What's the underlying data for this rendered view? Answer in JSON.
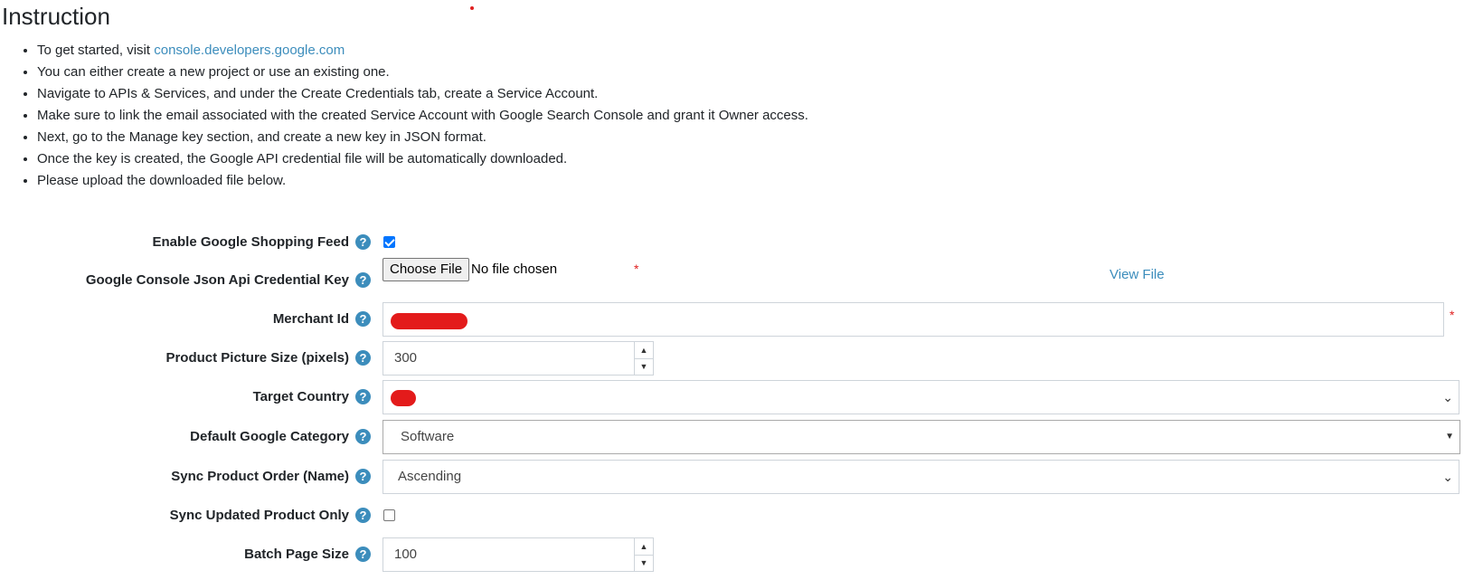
{
  "page": {
    "title": "Instruction",
    "instructions": [
      {
        "text": "To get started, visit ",
        "link": "console.developers.google.com"
      },
      {
        "text": "You can either create a new project or use an existing one."
      },
      {
        "text": "Navigate to APIs & Services, and under the Create Credentials tab, create a Service Account."
      },
      {
        "text": "Make sure to link the email associated with the created Service Account with Google Search Console and grant it Owner access."
      },
      {
        "text": "Next, go to the Manage key section, and create a new key in JSON format."
      },
      {
        "text": "Once the key is created, the Google API credential file will be automatically downloaded."
      },
      {
        "text": "Please upload the downloaded file below."
      }
    ]
  },
  "form": {
    "help_glyph": "?",
    "required_mark": "*",
    "enable_feed": {
      "label": "Enable Google Shopping Feed",
      "checked": true
    },
    "credential_key": {
      "label": "Google Console Json Api Credential Key",
      "button": "Choose File",
      "status": "No file chosen",
      "view_link": "View File"
    },
    "merchant_id": {
      "label": "Merchant Id",
      "value_redacted": true
    },
    "picture_size": {
      "label": "Product Picture Size (pixels)",
      "value": "300"
    },
    "target_country": {
      "label": "Target Country",
      "value_redacted": true
    },
    "default_category": {
      "label": "Default Google Category",
      "value": "Software"
    },
    "sync_order": {
      "label": "Sync Product Order (Name)",
      "value": "Ascending"
    },
    "sync_updated_only": {
      "label": "Sync Updated Product Only",
      "checked": false
    },
    "batch_page_size": {
      "label": "Batch Page Size",
      "value": "100"
    }
  },
  "icons": {
    "help": "question-circle-icon",
    "spin_up": "caret-up-icon",
    "spin_down": "caret-down-icon",
    "select": "chevron-down-icon"
  },
  "colors": {
    "link": "#3c8dbc",
    "help_icon": "#3c8dbc",
    "required": "#e02020",
    "checkbox_on": "#0075ff",
    "redaction": "#e31b1b"
  }
}
